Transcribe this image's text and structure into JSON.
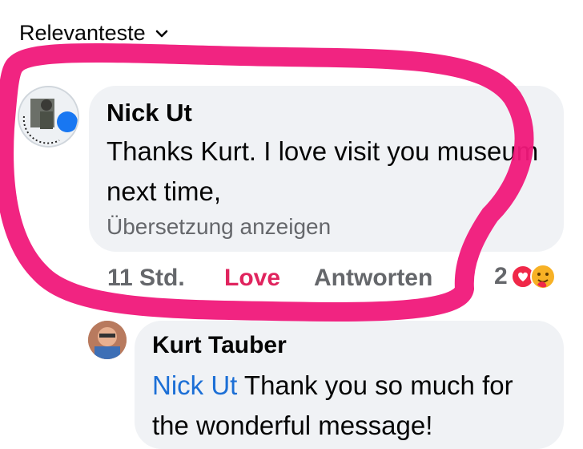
{
  "sort": {
    "label": "Relevanteste",
    "icon": "chevron-down-icon"
  },
  "comment": {
    "author": "Nick Ut",
    "text": "Thanks Kurt. I love visit you museum next time,",
    "translate": "Übersetzung anzeigen",
    "time": "11 Std.",
    "love": "Love",
    "reply": "Antworten",
    "reaction_count": "2",
    "reaction_icons": [
      "heart-icon",
      "care-icon"
    ]
  },
  "reply": {
    "author": "Kurt Tauber",
    "mention": "Nick Ut",
    "text": "Thank you so much for the wonderful message!"
  },
  "colors": {
    "love": "#e0245e",
    "mention": "#1c6fd6",
    "bubble": "#f0f2f5",
    "highlight": "#f0187a"
  }
}
